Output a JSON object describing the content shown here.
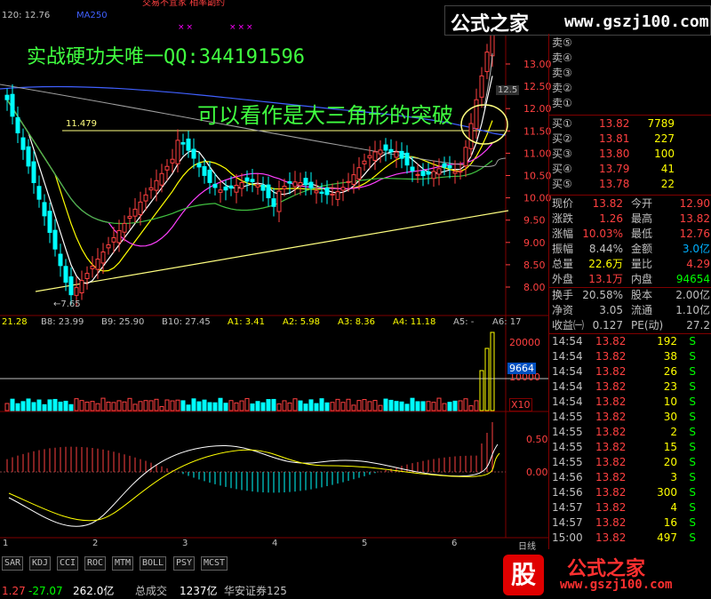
{
  "header": {
    "price_info": "120: 12.76",
    "ma_label": "MA250",
    "top_partial": "交易不宜家  相率副约",
    "title_banner": "实战硬功夫唯一QQ:344191596",
    "logo_cn": "公式之家",
    "logo_url": "www.gszj100.com"
  },
  "annotation": {
    "text": "可以看作是大三角形的突破",
    "level_label": "11.479",
    "low_label": "←7.65",
    "high_label": "12.5"
  },
  "price_axis": [
    "13.00",
    "12.50",
    "12.00",
    "11.50",
    "11.00",
    "10.50",
    "10.00",
    "9.50",
    "9.00",
    "8.50",
    "8.00"
  ],
  "indicator_row": [
    {
      "text": "21.28",
      "color": "#ffff00"
    },
    {
      "text": "B8: 23.99",
      "color": "#c0c0c0"
    },
    {
      "text": "B9: 25.90",
      "color": "#c0c0c0"
    },
    {
      "text": "B10: 27.45",
      "color": "#c0c0c0"
    },
    {
      "text": "A1: 3.41",
      "color": "#ffff00"
    },
    {
      "text": "A2: 5.98",
      "color": "#ffff00"
    },
    {
      "text": "A3: 8.36",
      "color": "#ffff00"
    },
    {
      "text": "A4: 11.18",
      "color": "#ffff00"
    },
    {
      "text": "A5: -",
      "color": "#c0c0c0"
    },
    {
      "text": "A6: 17",
      "color": "#c0c0c0"
    }
  ],
  "volume_axis": {
    "top": "20000",
    "mid": "10000",
    "highlight": "9664",
    "unit": "X10"
  },
  "macd_axis": {
    "top": "0.50",
    "zero": "0.00"
  },
  "date_axis": [
    "1",
    "2",
    "3",
    "4",
    "5",
    "6"
  ],
  "date_axis_end": "日线",
  "order_book": {
    "sells": [
      {
        "label": "卖⑤",
        "price": "",
        "vol": ""
      },
      {
        "label": "卖④",
        "price": "",
        "vol": ""
      },
      {
        "label": "卖③",
        "price": "",
        "vol": ""
      },
      {
        "label": "卖②",
        "price": "",
        "vol": ""
      },
      {
        "label": "卖①",
        "price": "",
        "vol": ""
      }
    ],
    "buys": [
      {
        "label": "买①",
        "price": "13.82",
        "vol": "7789"
      },
      {
        "label": "买②",
        "price": "13.81",
        "vol": "227"
      },
      {
        "label": "买③",
        "price": "13.80",
        "vol": "100"
      },
      {
        "label": "买④",
        "price": "13.79",
        "vol": "41"
      },
      {
        "label": "买⑤",
        "price": "13.78",
        "vol": "22"
      }
    ]
  },
  "stats": [
    {
      "l1": "现价",
      "v1": "13.82",
      "c1": "#ff4040",
      "l2": "今开",
      "v2": "12.90",
      "c2": "#ff4040"
    },
    {
      "l1": "涨跌",
      "v1": "1.26",
      "c1": "#ff4040",
      "l2": "最高",
      "v2": "13.82",
      "c2": "#ff4040"
    },
    {
      "l1": "涨幅",
      "v1": "10.03%",
      "c1": "#ff4040",
      "l2": "最低",
      "v2": "12.76",
      "c2": "#ff4040"
    },
    {
      "l1": "振幅",
      "v1": "8.44%",
      "c1": "#c0c0c0",
      "l2": "金额",
      "v2": "3.0亿",
      "c2": "#00b0ff"
    },
    {
      "l1": "总量",
      "v1": "22.6万",
      "c1": "#ffff00",
      "l2": "量比",
      "v2": "4.29",
      "c2": "#ff4040"
    },
    {
      "l1": "外盘",
      "v1": "13.1万",
      "c1": "#ff4040",
      "l2": "内盘",
      "v2": "94654",
      "c2": "#00ff00"
    },
    {
      "l1": "换手",
      "v1": "20.58%",
      "c1": "#c0c0c0",
      "l2": "股本",
      "v2": "2.00亿",
      "c2": "#c0c0c0"
    },
    {
      "l1": "净资",
      "v1": "3.05",
      "c1": "#c0c0c0",
      "l2": "流通",
      "v2": "1.10亿",
      "c2": "#c0c0c0"
    },
    {
      "l1": "收益㈠",
      "v1": "0.127",
      "c1": "#c0c0c0",
      "l2": "PE(动)",
      "v2": "27.2",
      "c2": "#c0c0c0"
    }
  ],
  "ticks": [
    {
      "time": "14:54",
      "price": "13.82",
      "vol": "192",
      "side": "S"
    },
    {
      "time": "14:54",
      "price": "13.82",
      "vol": "38",
      "side": "S"
    },
    {
      "time": "14:54",
      "price": "13.82",
      "vol": "26",
      "side": "S"
    },
    {
      "time": "14:54",
      "price": "13.82",
      "vol": "23",
      "side": "S"
    },
    {
      "time": "14:54",
      "price": "13.82",
      "vol": "10",
      "side": "S"
    },
    {
      "time": "14:55",
      "price": "13.82",
      "vol": "30",
      "side": "S"
    },
    {
      "time": "14:55",
      "price": "13.82",
      "vol": "2",
      "side": "S"
    },
    {
      "time": "14:55",
      "price": "13.82",
      "vol": "15",
      "side": "S"
    },
    {
      "time": "14:55",
      "price": "13.82",
      "vol": "20",
      "side": "S"
    },
    {
      "time": "14:56",
      "price": "13.82",
      "vol": "3",
      "side": "S"
    },
    {
      "time": "14:56",
      "price": "13.82",
      "vol": "300",
      "side": "S"
    },
    {
      "time": "14:57",
      "price": "13.82",
      "vol": "4",
      "side": "S"
    },
    {
      "time": "14:57",
      "price": "13.82",
      "vol": "16",
      "side": "S"
    },
    {
      "time": "15:00",
      "price": "13.82",
      "vol": "497",
      "side": "S"
    }
  ],
  "tabs": [
    "SAR",
    "KDJ",
    "CCI",
    "ROC",
    "MTM",
    "BOLL",
    "PSY",
    "MCST"
  ],
  "status": [
    {
      "text": "1.27",
      "color": "#ff4040"
    },
    {
      "text": "-27.07",
      "color": "#00ff00"
    },
    {
      "text": "262.0亿",
      "color": "#ffffff"
    },
    {
      "text": "总成交",
      "color": "#c0c0c0"
    },
    {
      "text": "1237亿",
      "color": "#ffffff"
    },
    {
      "text": "华安证券125",
      "color": "#c0c0c0"
    }
  ],
  "bottom_logo": {
    "badge": "股",
    "cn": "公式之家",
    "url": "www.gszj100.com"
  },
  "colors": {
    "up": "#ff4040",
    "down": "#00ffff",
    "bg": "#000000",
    "grid": "#800000",
    "accent": "#ffff00"
  }
}
